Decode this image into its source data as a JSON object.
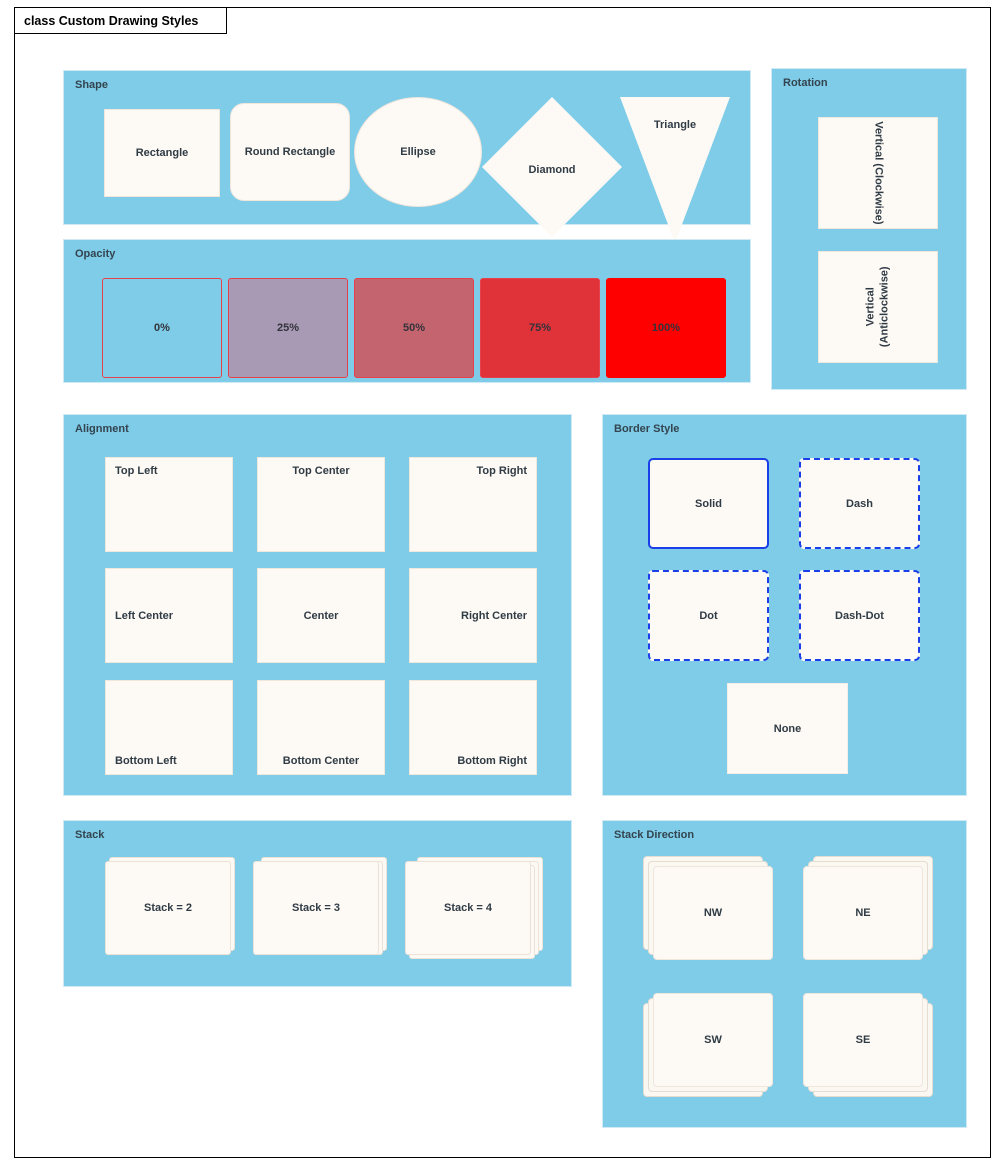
{
  "frame": {
    "title": "class Custom Drawing Styles"
  },
  "panels": {
    "shape": {
      "title": "Shape",
      "items": [
        {
          "label": "Rectangle",
          "shape": "rectangle"
        },
        {
          "label": "Round Rectangle",
          "shape": "round-rectangle"
        },
        {
          "label": "Ellipse",
          "shape": "ellipse"
        },
        {
          "label": "Diamond",
          "shape": "diamond"
        },
        {
          "label": "Triangle",
          "shape": "triangle"
        }
      ]
    },
    "opacity": {
      "title": "Opacity",
      "fill_color": "#ff0000",
      "border_color": "#e8404a",
      "items": [
        {
          "label": "0%",
          "opacity": 0.0,
          "rendered_color": "#7fcce8"
        },
        {
          "label": "25%",
          "opacity": 0.25,
          "rendered_color": "#a89ab4"
        },
        {
          "label": "50%",
          "opacity": 0.5,
          "rendered_color": "#c4646f"
        },
        {
          "label": "75%",
          "opacity": 0.75,
          "rendered_color": "#e03239"
        },
        {
          "label": "100%",
          "opacity": 1.0,
          "rendered_color": "#ff0000"
        }
      ]
    },
    "rotation": {
      "title": "Rotation",
      "items": [
        {
          "label": "Vertical (Clockwise)",
          "direction": "clockwise",
          "lines": [
            "Vertical (Clockwise)"
          ]
        },
        {
          "label": "Vertical (Anticlockwise)",
          "direction": "anticlockwise",
          "lines": [
            "Vertical",
            "(Anticlockwise)"
          ]
        }
      ]
    },
    "alignment": {
      "title": "Alignment",
      "items": [
        {
          "label": "Top Left",
          "vertical": "top",
          "horizontal": "left"
        },
        {
          "label": "Top Center",
          "vertical": "top",
          "horizontal": "center"
        },
        {
          "label": "Top Right",
          "vertical": "top",
          "horizontal": "right"
        },
        {
          "label": "Left Center",
          "vertical": "middle",
          "horizontal": "left"
        },
        {
          "label": "Center",
          "vertical": "middle",
          "horizontal": "center"
        },
        {
          "label": "Right Center",
          "vertical": "middle",
          "horizontal": "right"
        },
        {
          "label": "Bottom Left",
          "vertical": "bottom",
          "horizontal": "left"
        },
        {
          "label": "Bottom Center",
          "vertical": "bottom",
          "horizontal": "center"
        },
        {
          "label": "Bottom Right",
          "vertical": "bottom",
          "horizontal": "right"
        }
      ]
    },
    "border_style": {
      "title": "Border Style",
      "border_color": "#1a3ee8",
      "items": [
        {
          "label": "Solid",
          "style": "solid"
        },
        {
          "label": "Dash",
          "style": "dash"
        },
        {
          "label": "Dot",
          "style": "dot"
        },
        {
          "label": "Dash-Dot",
          "style": "dash-dot"
        },
        {
          "label": "None",
          "style": "none"
        }
      ]
    },
    "stack": {
      "title": "Stack",
      "items": [
        {
          "label": "Stack = 2",
          "count": 2
        },
        {
          "label": "Stack = 3",
          "count": 3
        },
        {
          "label": "Stack = 4",
          "count": 4
        }
      ]
    },
    "stack_direction": {
      "title": "Stack Direction",
      "items": [
        {
          "label": "NW",
          "direction": "north-west"
        },
        {
          "label": "NE",
          "direction": "north-east"
        },
        {
          "label": "SW",
          "direction": "south-west"
        },
        {
          "label": "SE",
          "direction": "south-east"
        }
      ]
    }
  },
  "colors": {
    "panel_background": "#7fcce8",
    "panel_border": "#cfe9f5",
    "card_fill": "#fdf9f4",
    "card_border": "#efe6dc",
    "text": "#2f3b45",
    "frame_border": "#000000"
  }
}
